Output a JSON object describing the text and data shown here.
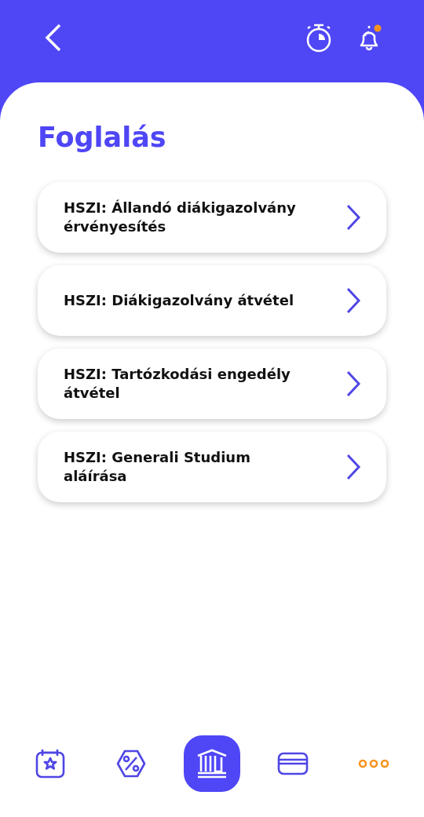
{
  "header": {
    "notification_dot": true
  },
  "title": "Foglalás",
  "items": [
    {
      "label": "HSZI: Állandó diákigazolvány érvényesítés"
    },
    {
      "label": "HSZI: Diákigazolvány átvétel"
    },
    {
      "label": "HSZI: Tartózkodási engedély átvétel"
    },
    {
      "label": "HSZI: Generali Studium aláírása"
    }
  ],
  "nav": [
    {
      "kind": "calendar",
      "selected": false
    },
    {
      "kind": "discount",
      "selected": false
    },
    {
      "kind": "bank",
      "selected": true
    },
    {
      "kind": "card",
      "selected": false
    },
    {
      "kind": "more",
      "selected": false
    }
  ]
}
